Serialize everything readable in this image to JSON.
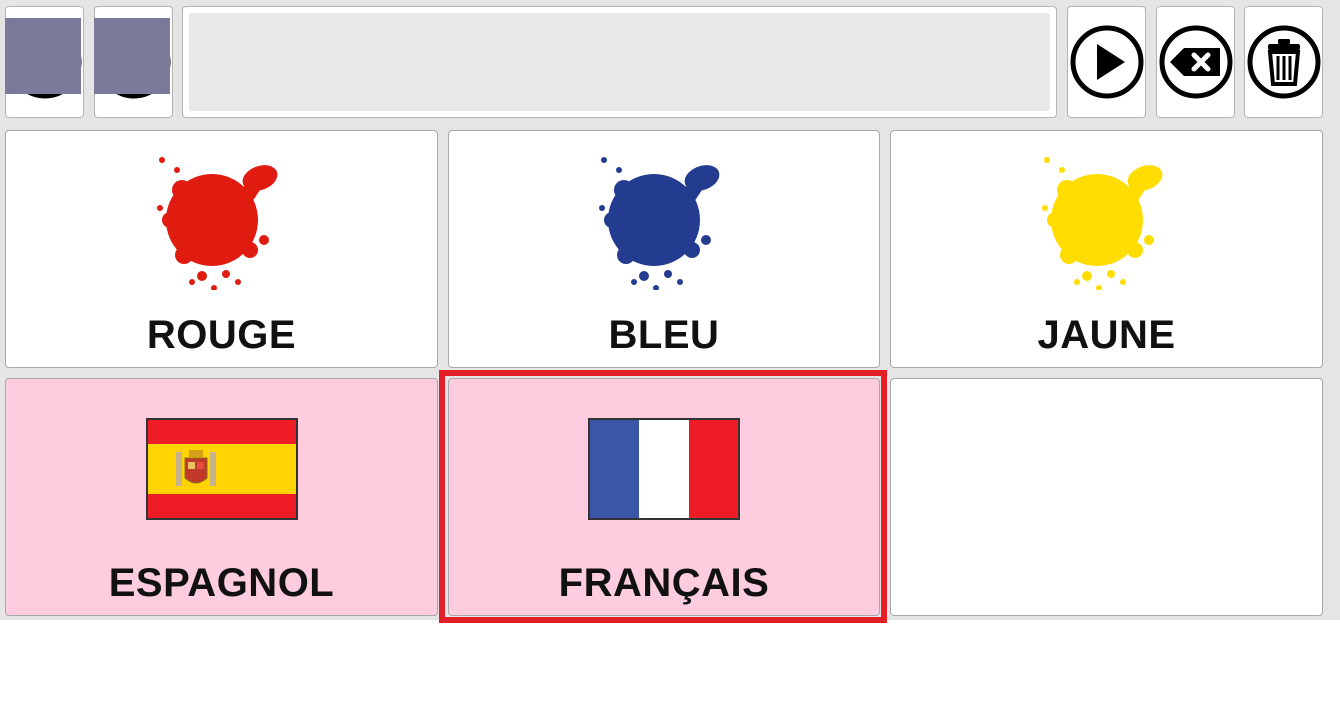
{
  "toolbar": {
    "home_icon": "home-icon",
    "undo_icon": "undo-icon",
    "play_icon": "play-icon",
    "backspace_icon": "backspace-icon",
    "trash_icon": "trash-icon"
  },
  "message_bar": {
    "text": ""
  },
  "grid": {
    "cells": [
      {
        "label": "ROUGE",
        "icon": "red-paint-splash",
        "color": "#e01b10"
      },
      {
        "label": "BLEU",
        "icon": "blue-paint-splash",
        "color": "#233c90"
      },
      {
        "label": "JAUNE",
        "icon": "yellow-paint-splash",
        "color": "#ffdd00"
      },
      {
        "label": "ESPAGNOL",
        "icon": "spain-flag",
        "background": "#fdccdf"
      },
      {
        "label": "FRANÇAIS",
        "icon": "france-flag",
        "background": "#fdccdf",
        "selected": true
      },
      {
        "label": "",
        "icon": ""
      }
    ]
  },
  "colors": {
    "focus_ring": "#e41e26",
    "tile_pink": "#fdccdf",
    "board_bg": "#e5e5e5"
  }
}
